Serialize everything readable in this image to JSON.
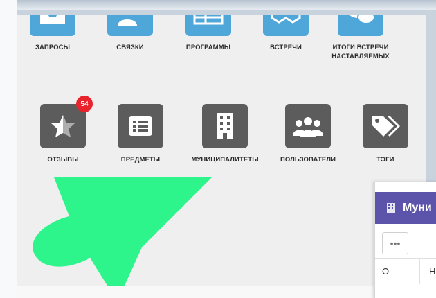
{
  "row1": [
    {
      "label": "ЗАПРОСЫ",
      "icon": "inbox-download-icon"
    },
    {
      "label": "СВЯЗКИ",
      "icon": "add-user-icon"
    },
    {
      "label": "ПРОГРАММЫ",
      "icon": "table-grid-icon"
    },
    {
      "label": "ВСТРЕЧИ",
      "icon": "handshake-icon"
    },
    {
      "label": "ИТОГИ ВСТРЕЧИ НАСТАВЛЯЕМЫХ",
      "icon": "chat-bubbles-icon"
    }
  ],
  "row2": [
    {
      "label": "ОТЗЫВЫ",
      "icon": "star-icon",
      "badge": "54"
    },
    {
      "label": "ПРЕДМЕТЫ",
      "icon": "list-icon"
    },
    {
      "label": "МУНИЦИПАЛИТЕТЫ",
      "icon": "building-icon"
    },
    {
      "label": "ПОЛЬЗОВАТЕЛИ",
      "icon": "users-group-icon"
    },
    {
      "label": "ТЭГИ",
      "icon": "tags-icon"
    }
  ],
  "popup": {
    "title": "Муни",
    "more": "•••",
    "col1": "О",
    "col2": "Н"
  },
  "colors": {
    "accent_blue": "#4fa6d9",
    "dark_tile": "#5c5c5c",
    "badge": "#e8232b",
    "popup_header": "#5b54aa",
    "arrow": "#2ef58b"
  }
}
